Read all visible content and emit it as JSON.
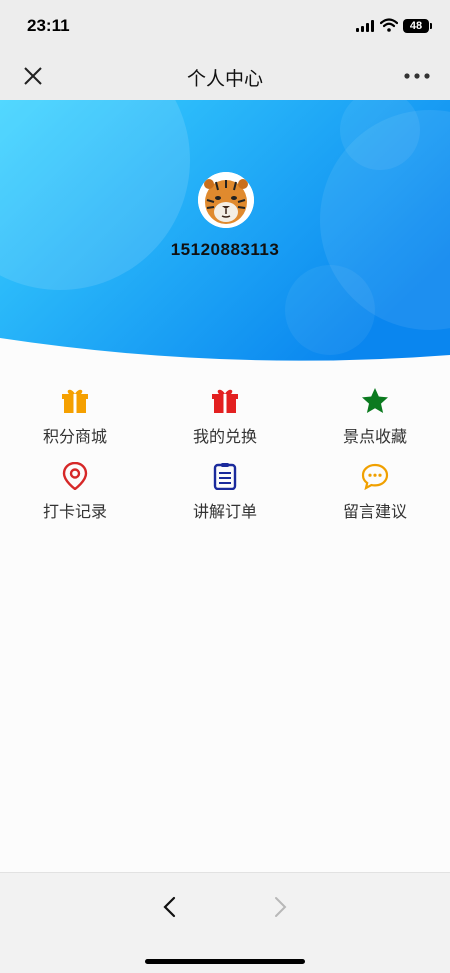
{
  "status_bar": {
    "time": "23:11",
    "battery": "48",
    "icons": [
      "signal-icon",
      "wifi-icon",
      "battery-icon"
    ]
  },
  "nav": {
    "title": "个人中心",
    "close_icon": "close-icon",
    "more_icon": "more-icon"
  },
  "profile": {
    "phone": "15120883113",
    "avatar": "tiger-avatar"
  },
  "menu": [
    {
      "label": "积分商城",
      "icon": "gift-icon",
      "color": "#f5a000"
    },
    {
      "label": "我的兑换",
      "icon": "gift-icon",
      "color": "#e32020"
    },
    {
      "label": "景点收藏",
      "icon": "star-icon",
      "color": "#0b7a1f"
    },
    {
      "label": "打卡记录",
      "icon": "location-pin-icon",
      "color": "#d62828"
    },
    {
      "label": "讲解订单",
      "icon": "clipboard-icon",
      "color": "#1a2a9c"
    },
    {
      "label": "留言建议",
      "icon": "chat-bubble-icon",
      "color": "#f0a000"
    }
  ],
  "toolbar": {
    "back_icon": "chevron-left-icon",
    "forward_icon": "chevron-right-icon"
  },
  "colors": {
    "hero_start": "#3bd3ff",
    "hero_end": "#0a86ef",
    "bar_background": "#ededed"
  }
}
